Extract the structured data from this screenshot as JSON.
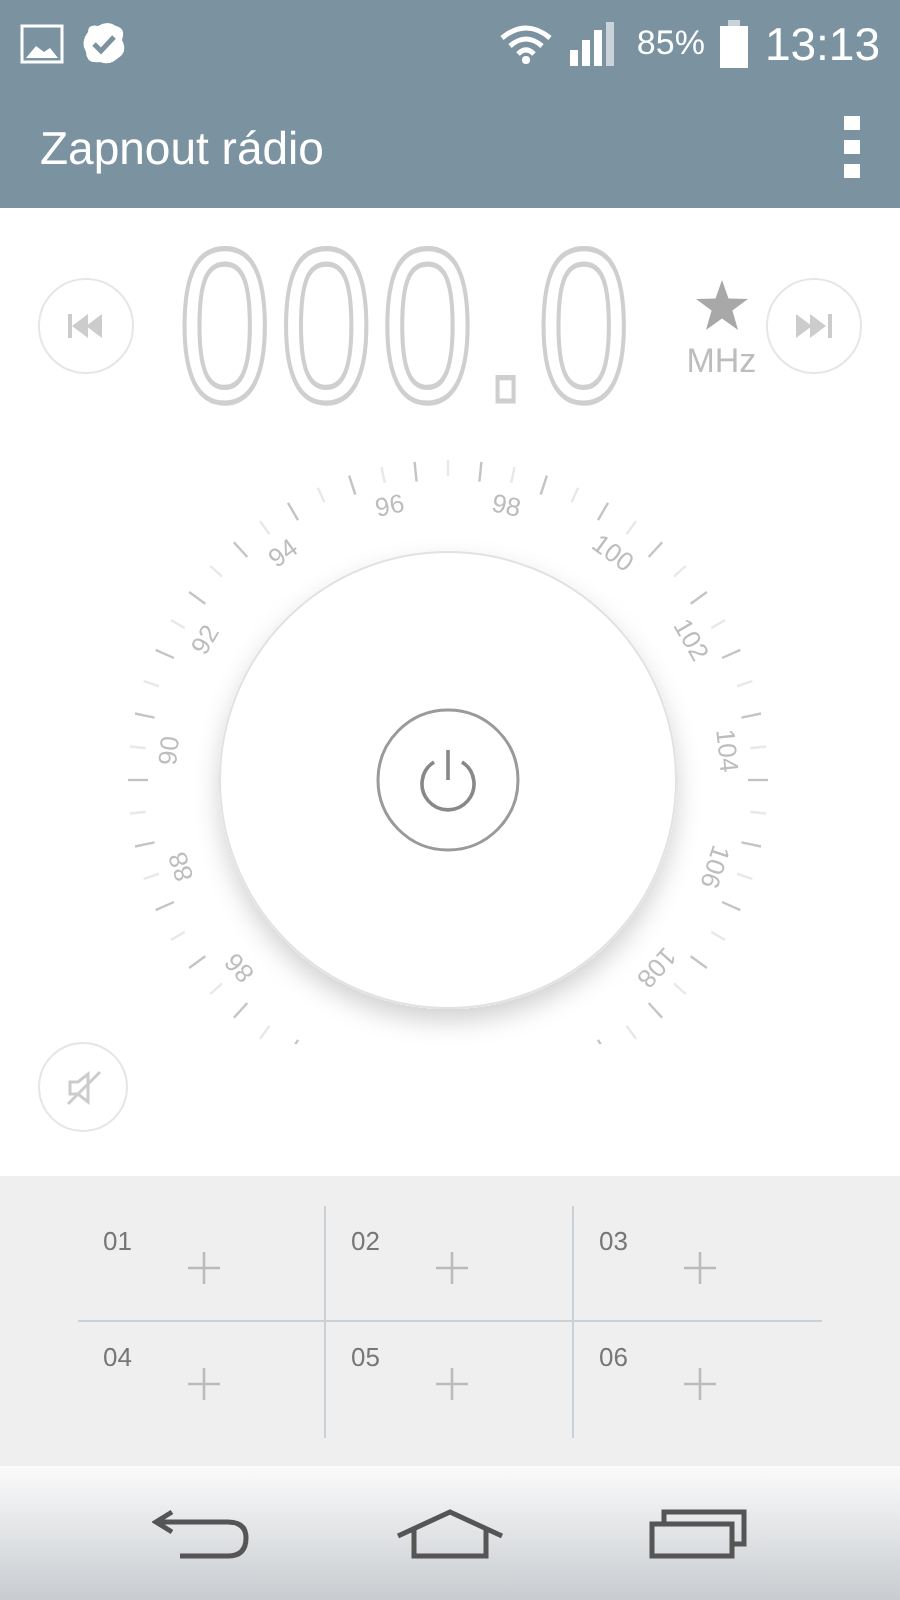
{
  "status_bar": {
    "battery": "85%",
    "time": "13:13"
  },
  "app_bar": {
    "title": "Zapnout rádio"
  },
  "tuner": {
    "frequency": "000.0",
    "unit": "MHz"
  },
  "dial": {
    "scale_labels": [
      "86",
      "88",
      "90",
      "92",
      "94",
      "96",
      "98",
      "100",
      "102",
      "104",
      "106",
      "108"
    ]
  },
  "presets": [
    {
      "number": "01"
    },
    {
      "number": "02"
    },
    {
      "number": "03"
    },
    {
      "number": "04"
    },
    {
      "number": "05"
    },
    {
      "number": "06"
    }
  ]
}
